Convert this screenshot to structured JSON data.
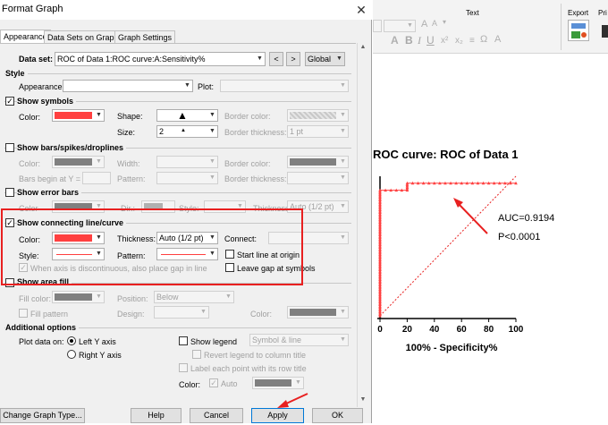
{
  "dialog": {
    "title": "Format Graph",
    "close_glyph": "✕",
    "tabs": [
      {
        "label": "Appearance",
        "active": true
      },
      {
        "label": "Data Sets on Graph",
        "active": false
      },
      {
        "label": "Graph Settings",
        "active": false
      }
    ],
    "dataset": {
      "label": "Data set:",
      "value": "ROC of Data 1:ROC curve:A:Sensitivity%",
      "prev": "<",
      "next": ">",
      "scope": "Global"
    },
    "style": {
      "header": "Style",
      "appearance_label": "Appearance:",
      "plot_label": "Plot:"
    },
    "symbols": {
      "checkbox_label": "Show symbols",
      "checked": true,
      "color_label": "Color:",
      "color": "#ff4040",
      "shape_label": "Shape:",
      "shape_glyph": "▲",
      "size_label": "Size:",
      "size_value": "2",
      "size_glyph": "▲",
      "border_color_label": "Border color:",
      "border_thickness_label": "Border thickness:",
      "border_thickness_value": "1 pt"
    },
    "bars": {
      "checkbox_label": "Show bars/spikes/droplines",
      "checked": false,
      "color_label": "Color:",
      "width_label": "Width:",
      "border_color_label": "Border color:",
      "bars_begin_label": "Bars begin at Y =",
      "pattern_label": "Pattern:",
      "border_thickness_label": "Border thickness:"
    },
    "error_bars": {
      "checkbox_label": "Show error bars",
      "checked": false,
      "color_label": "Color",
      "dir_label": "Dir.:",
      "style_label": "Style:",
      "thickness_label": "Thickness:",
      "thickness_value": "Auto (1/2 pt)"
    },
    "connecting_line": {
      "checkbox_label": "Show connecting line/curve",
      "checked": true,
      "color_label": "Color:",
      "color": "#ff4040",
      "thickness_label": "Thickness:",
      "thickness_value": "Auto (1/2 pt)",
      "connect_label": "Connect:",
      "style_label": "Style:",
      "pattern_label": "Pattern:",
      "start_at_origin_label": "Start line at origin",
      "start_at_origin_checked": false,
      "gap_at_symbols_label": "Leave gap at symbols",
      "gap_at_symbols_checked": false,
      "discontinuous_label": "When axis is discontinuous, also place gap in line"
    },
    "area_fill": {
      "checkbox_label": "Show area fill",
      "checked": false,
      "fill_color_label": "Fill color:",
      "position_label": "Position:",
      "position_value": "Below",
      "fill_pattern_label": "Fill pattern",
      "design_label": "Design:",
      "color_label": "Color:"
    },
    "additional": {
      "header": "Additional options",
      "plot_on_label": "Plot data on:",
      "left_axis_label": "Left Y axis",
      "right_axis_label": "Right  Y axis",
      "left_selected": true,
      "show_legend_label": "Show legend",
      "show_legend_checked": false,
      "legend_mode_value": "Symbol & line",
      "revert_legend_label": "Revert legend to column title",
      "label_each_point_label": "Label each point with its row title",
      "color_label": "Color:",
      "auto_label": "Auto",
      "auto_checked": true
    },
    "buttons": {
      "change_type": "Change Graph Type...",
      "help": "Help",
      "cancel": "Cancel",
      "apply": "Apply",
      "ok": "OK"
    }
  },
  "ribbon": {
    "text_group": "Text",
    "export_group": "Export",
    "print_group": "Pri"
  },
  "chart_data": {
    "type": "line",
    "title": "ROC curve: ROC of Data 1",
    "xlabel": "100% - Specificity%",
    "ylabel": "",
    "xlim": [
      0,
      100
    ],
    "ylim": [
      0,
      100
    ],
    "x_ticks": [
      0,
      20,
      40,
      60,
      80,
      100
    ],
    "series": [
      {
        "color": "#ff4040",
        "x": [
          0,
          0,
          0,
          0,
          0,
          0,
          0,
          0,
          0,
          0,
          0,
          0,
          0,
          0,
          0,
          0,
          0,
          0,
          0,
          0,
          0,
          0,
          0,
          0,
          0,
          0,
          0,
          0,
          0,
          0,
          0,
          0,
          0,
          0,
          0,
          0,
          0,
          0,
          0,
          0,
          0,
          0,
          0,
          0,
          0,
          0,
          0,
          0,
          0,
          0,
          0,
          0,
          0,
          0,
          0,
          0,
          0,
          0,
          0,
          0,
          0,
          0,
          0,
          0,
          0,
          0,
          0,
          0,
          0,
          0,
          0,
          0,
          0,
          0,
          0,
          0,
          0,
          0,
          0,
          0,
          0,
          0,
          0,
          0,
          0,
          0,
          0,
          0,
          0,
          0,
          0,
          4,
          8,
          12,
          16,
          20,
          20,
          20,
          20,
          20,
          20,
          24,
          28,
          32,
          36,
          40,
          44,
          48,
          52,
          56,
          60,
          64,
          68,
          72,
          76,
          80,
          84,
          88,
          92,
          96,
          100
        ],
        "y": [
          0,
          1,
          2,
          3,
          4,
          5,
          6,
          7,
          8,
          9,
          10,
          11,
          12,
          13,
          14,
          15,
          16,
          17,
          18,
          19,
          20,
          21,
          22,
          23,
          24,
          25,
          26,
          27,
          28,
          29,
          30,
          31,
          32,
          33,
          34,
          35,
          36,
          37,
          38,
          39,
          40,
          41,
          42,
          43,
          44,
          45,
          46,
          47,
          48,
          49,
          50,
          51,
          52,
          53,
          54,
          55,
          56,
          57,
          58,
          59,
          60,
          61,
          62,
          63,
          64,
          65,
          66,
          67,
          68,
          69,
          70,
          71,
          72,
          73,
          74,
          75,
          76,
          77,
          78,
          79,
          80,
          81,
          82,
          83,
          84,
          85,
          86,
          87,
          88,
          89,
          90,
          90,
          90,
          90,
          90,
          90,
          91,
          92,
          93,
          94,
          95,
          95,
          95,
          95,
          95,
          95,
          95,
          95,
          95,
          95,
          95,
          95,
          95,
          95,
          95,
          95,
          95,
          95,
          95,
          95,
          95
        ]
      }
    ],
    "annotations": [
      "AUC=0.9194",
      "P<0.0001"
    ],
    "grid": false,
    "reference_line": "diagonal dashed"
  }
}
